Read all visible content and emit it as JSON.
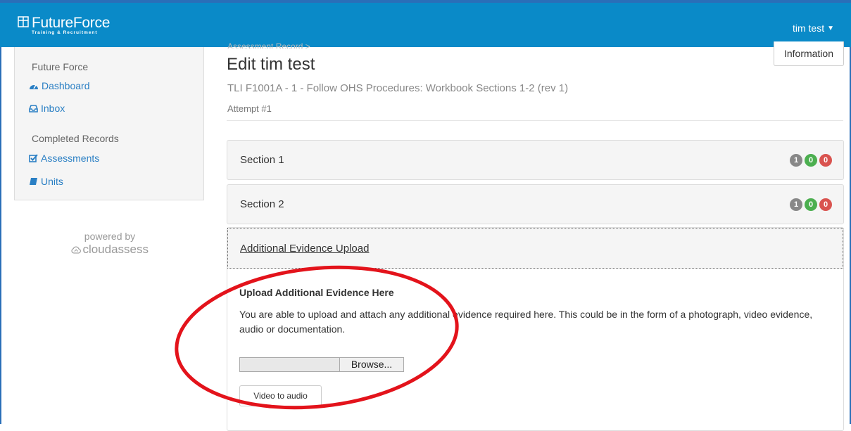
{
  "colors": {
    "nav": "#0a8ac8",
    "link": "#2a7fc4",
    "annotation": "#e3131b",
    "badge_grey": "#888888",
    "badge_green": "#4caf50",
    "badge_red": "#d9534f"
  },
  "navbar": {
    "logo_name": "FutureForce",
    "logo_tagline": "Training & Recruitment",
    "user": "tim test"
  },
  "sidebar": {
    "groups": [
      {
        "heading": "Future Force",
        "links": [
          {
            "label": "Dashboard",
            "icon": "dashboard-icon"
          },
          {
            "label": "Inbox",
            "icon": "inbox-icon"
          }
        ]
      },
      {
        "heading": "Completed Records",
        "links": [
          {
            "label": "Assessments",
            "icon": "checkbox-icon"
          },
          {
            "label": "Units",
            "icon": "book-icon"
          }
        ]
      }
    ],
    "powered_by": "powered by",
    "brand": "cloudassess"
  },
  "main": {
    "breadcrumb": "Assessment Record >",
    "title": "Edit tim test",
    "subtitle": "TLI F1001A - 1 - Follow OHS Procedures: Workbook Sections 1-2 (rev 1)",
    "attempt": "Attempt #1",
    "information_button": "Information",
    "sections": [
      {
        "title": "Section 1",
        "badges": [
          "1",
          "0",
          "0"
        ]
      },
      {
        "title": "Section 2",
        "badges": [
          "1",
          "0",
          "0"
        ]
      }
    ],
    "upload": {
      "header": "Additional Evidence Upload",
      "heading": "Upload Additional Evidence Here",
      "description": "You are able to upload and attach any additional evidence required here. This could be in the form of a photograph, video evidence, audio or documentation.",
      "browse": "Browse...",
      "video_button": "Video to audio"
    }
  }
}
